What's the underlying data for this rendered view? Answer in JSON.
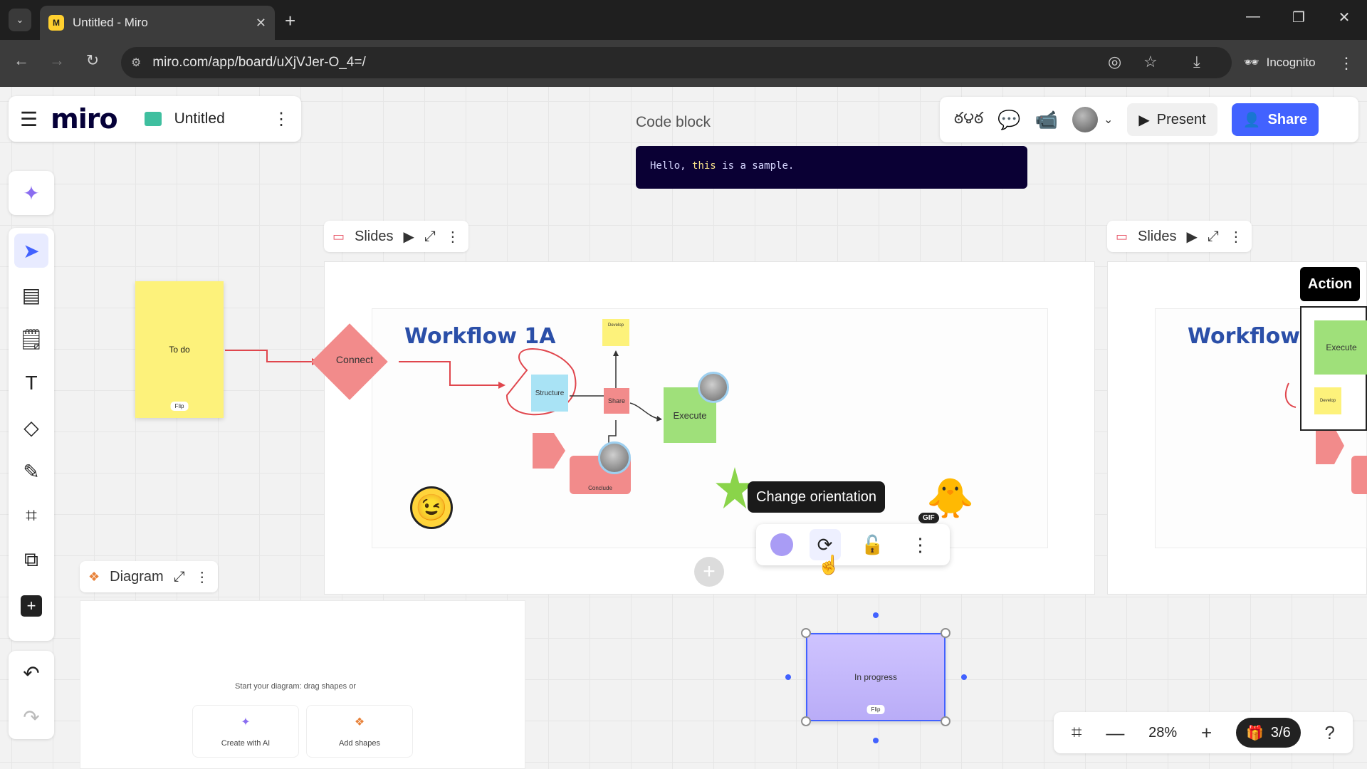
{
  "browser": {
    "tab_title": "Untitled - Miro",
    "favicon_text": "M",
    "url": "miro.com/app/board/uXjVJer-O_4=/",
    "incognito_label": "Incognito"
  },
  "board": {
    "logo": "miro",
    "title": "Untitled"
  },
  "code_block": {
    "label": "Code block",
    "code_before": "Hello, ",
    "code_keyword": "this",
    "code_after": " is a sample."
  },
  "header_actions": {
    "reactions_label": "ఠ౪ఠ",
    "present_label": "Present",
    "share_label": "Share"
  },
  "frames": [
    {
      "label": "Slides"
    },
    {
      "label": "Slides"
    },
    {
      "label": "Diagram"
    }
  ],
  "canvas": {
    "sticky_todo": "To do",
    "sticky_tag": "Flip",
    "connect": "Connect",
    "workflow_title": "Workflow 1A",
    "workflow_title_right": "Workflow",
    "structure": "Structure",
    "develop": "Develop",
    "share_node": "Share",
    "execute": "Execute",
    "conclude": "Conclude",
    "in_progress": "In progress",
    "in_progress_tag": "Flip",
    "gif_label": "GIF",
    "diagram_hint": "Start your diagram: drag shapes or",
    "create_ai": "Create with AI",
    "add_shapes": "Add shapes",
    "action_label": "Action",
    "right_execute": "Execute",
    "right_develop": "Develop"
  },
  "context_menu": {
    "tooltip": "Change orientation"
  },
  "zoom": {
    "value": "28%",
    "page": "3/6"
  },
  "colors": {
    "accent": "#4262ff",
    "sticky_yellow": "#fdf27b",
    "in_progress_purple": "#b9acf7",
    "connector_red": "#e0464d"
  }
}
